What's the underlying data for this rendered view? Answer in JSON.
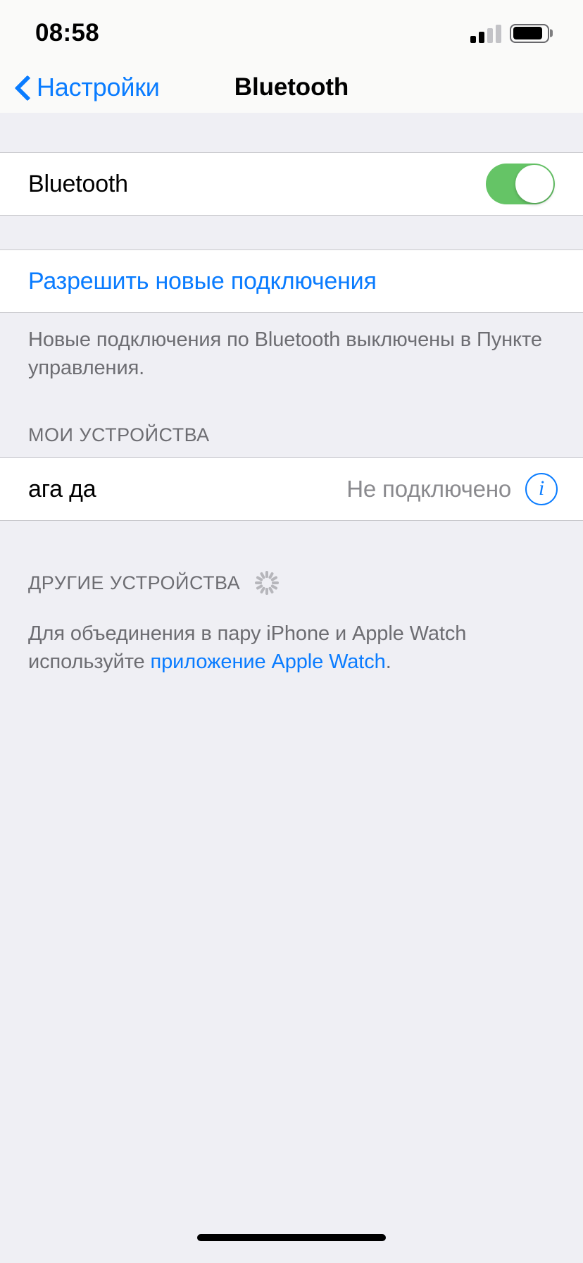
{
  "status_bar": {
    "time": "08:58",
    "signal_icon": "cellular-signal-icon",
    "signal_bars_filled": 2,
    "signal_bars_total": 4,
    "battery_icon": "battery-icon",
    "battery_level_percent": 88
  },
  "nav": {
    "back_label": "Настройки",
    "back_icon": "chevron-left-icon",
    "title": "Bluetooth"
  },
  "bluetooth": {
    "label": "Bluetooth",
    "toggle_state": "on",
    "toggle_color": "#65C466"
  },
  "allow_connections": {
    "label": "Разрешить новые подключения",
    "footnote": "Новые подключения по Bluetooth выключены в Пункте управления."
  },
  "my_devices": {
    "header": "МОИ УСТРОЙСТВА",
    "items": [
      {
        "name": "ага да",
        "status": "Не подключено",
        "info_icon": "info-circle-icon"
      }
    ]
  },
  "other_devices": {
    "header": "ДРУГИЕ УСТРОЙСТВА",
    "spinner_icon": "activity-spinner-icon",
    "footnote_before_link": "Для объединения в пару iPhone и Apple Watch используйте ",
    "footnote_link": "приложение Apple Watch",
    "footnote_after_link": "."
  },
  "home_indicator": {
    "name": "home-indicator"
  },
  "colors": {
    "accent_blue": "#0A7CFF",
    "toggle_green": "#65C466",
    "grouped_background": "#EFEFF4",
    "row_background": "#FFFFFF",
    "secondary_text": "#6D6D72"
  }
}
